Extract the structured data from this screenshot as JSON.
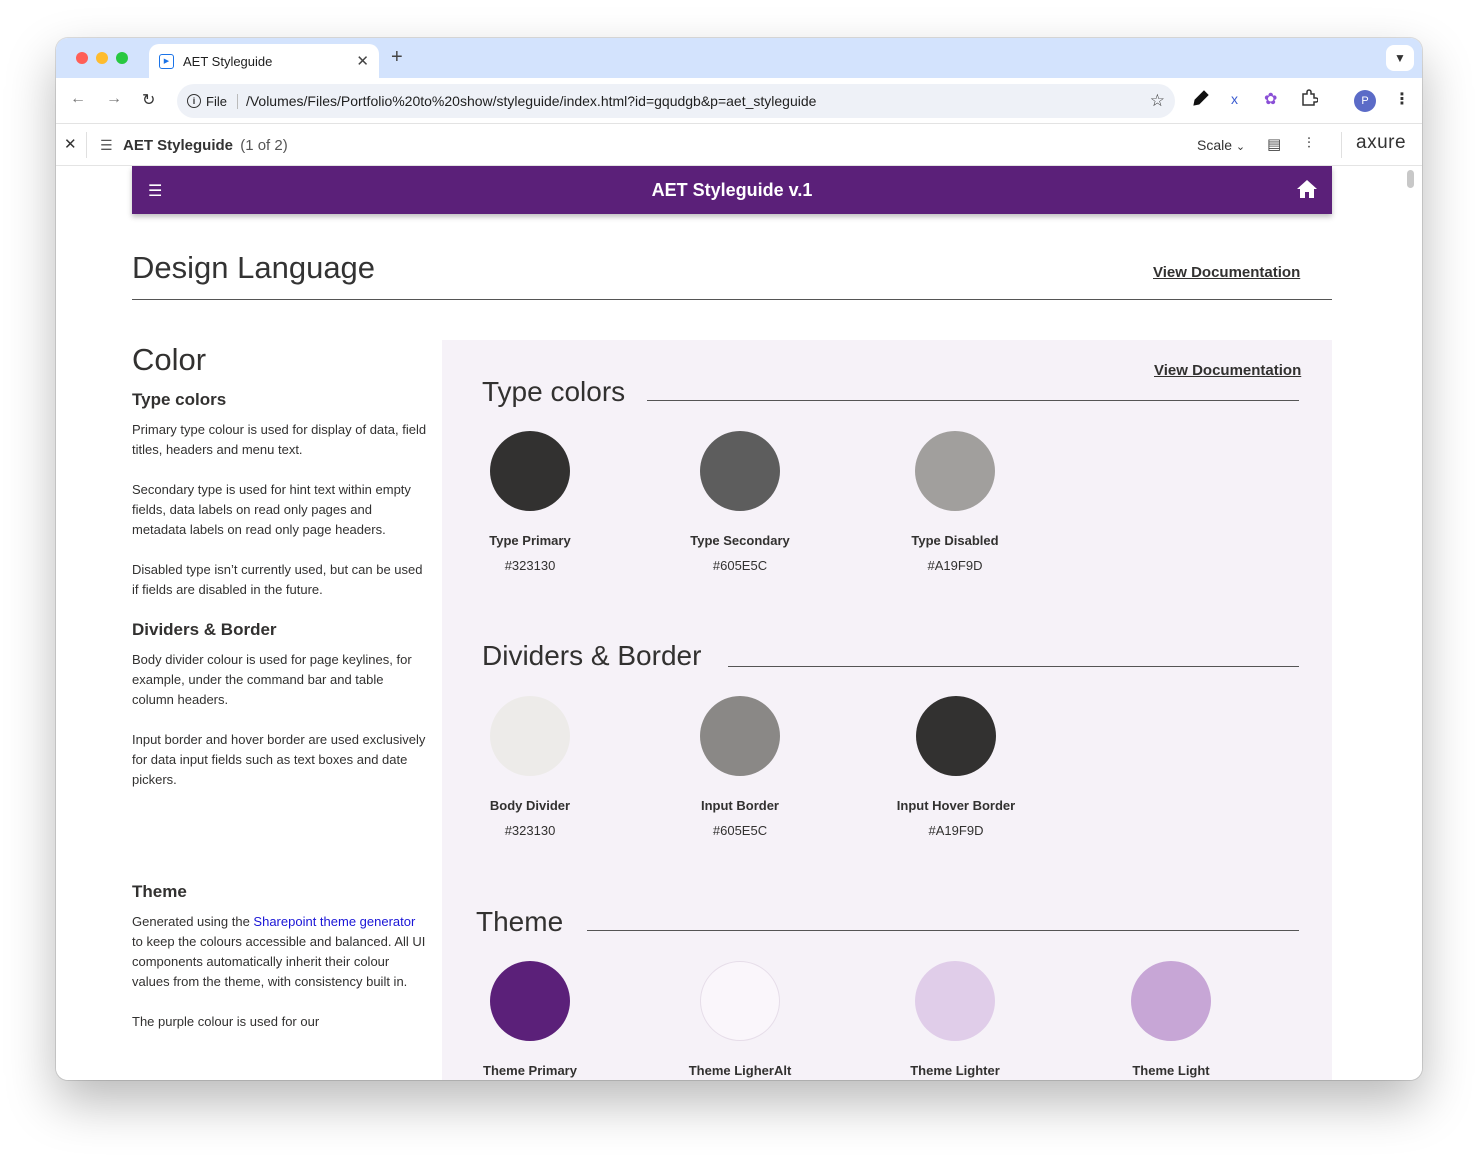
{
  "browser": {
    "tab_title": "AET Styleguide",
    "new_tab": "+",
    "chip": "File",
    "url": "/Volumes/Files/Portfolio%20to%20show/styleguide/index.html?id=gqudgb&p=aet_styleguide",
    "profile_initial": "P"
  },
  "axure": {
    "page_title": "AET Styleguide",
    "page_count": "(1 of 2)",
    "scale_label": "Scale",
    "logo": "axure"
  },
  "header": {
    "title": "AET Styleguide v.1"
  },
  "design_language": {
    "title": "Design Language",
    "link": "View Documentation"
  },
  "left": {
    "color_heading": "Color",
    "type_colors_heading": "Type colors",
    "type_p1": "Primary type colour is used for display of data, field titles, headers and menu text.",
    "type_p2": "Secondary type is used for hint text within empty fields, data labels on read only pages and metadata labels on read only page headers.",
    "type_p3": "Disabled type isn’t currently used, but can be used if fields are disabled in the future.",
    "dividers_heading": "Dividers & Border",
    "div_p1": "Body divider colour is used for page keylines, for example, under the command bar and table column headers.",
    "div_p2": "Input border and hover border are used exclusively for data input fields such as text boxes and date pickers.",
    "theme_heading": "Theme",
    "theme_p1_a": "Generated using the ",
    "theme_p1_link": "Sharepoint theme generator",
    "theme_p1_b": " to keep the colours accessible and balanced. All UI components automatically inherit their colour values from the theme, with consistency built in.",
    "theme_p2": "The purple colour is used for our"
  },
  "panel": {
    "link": "View Documentation",
    "type_colors": {
      "title": "Type colors",
      "swatches": [
        {
          "name": "Type Primary",
          "hex": "#323130",
          "color": "#323130"
        },
        {
          "name": "Type Secondary",
          "hex": "#605E5C",
          "color": "#5d5d5d"
        },
        {
          "name": "Type Disabled",
          "hex": "#A19F9D",
          "color": "#a19f9d"
        }
      ]
    },
    "dividers": {
      "title": "Dividers & Border",
      "swatches": [
        {
          "name": "Body Divider",
          "hex": "#323130",
          "color": "#edebe9"
        },
        {
          "name": "Input Border",
          "hex": "#605E5C",
          "color": "#8a8886"
        },
        {
          "name": "Input Hover Border",
          "hex": "#A19F9D",
          "color": "#323130"
        }
      ]
    },
    "theme": {
      "title": "Theme",
      "swatches": [
        {
          "name": "Theme Primary",
          "color": "#5b2079"
        },
        {
          "name": "Theme LigherAlt",
          "color": "#faf6fb"
        },
        {
          "name": "Theme Lighter",
          "color": "#e0cde9"
        },
        {
          "name": "Theme Light",
          "color": "#c7a6d6"
        }
      ]
    }
  }
}
